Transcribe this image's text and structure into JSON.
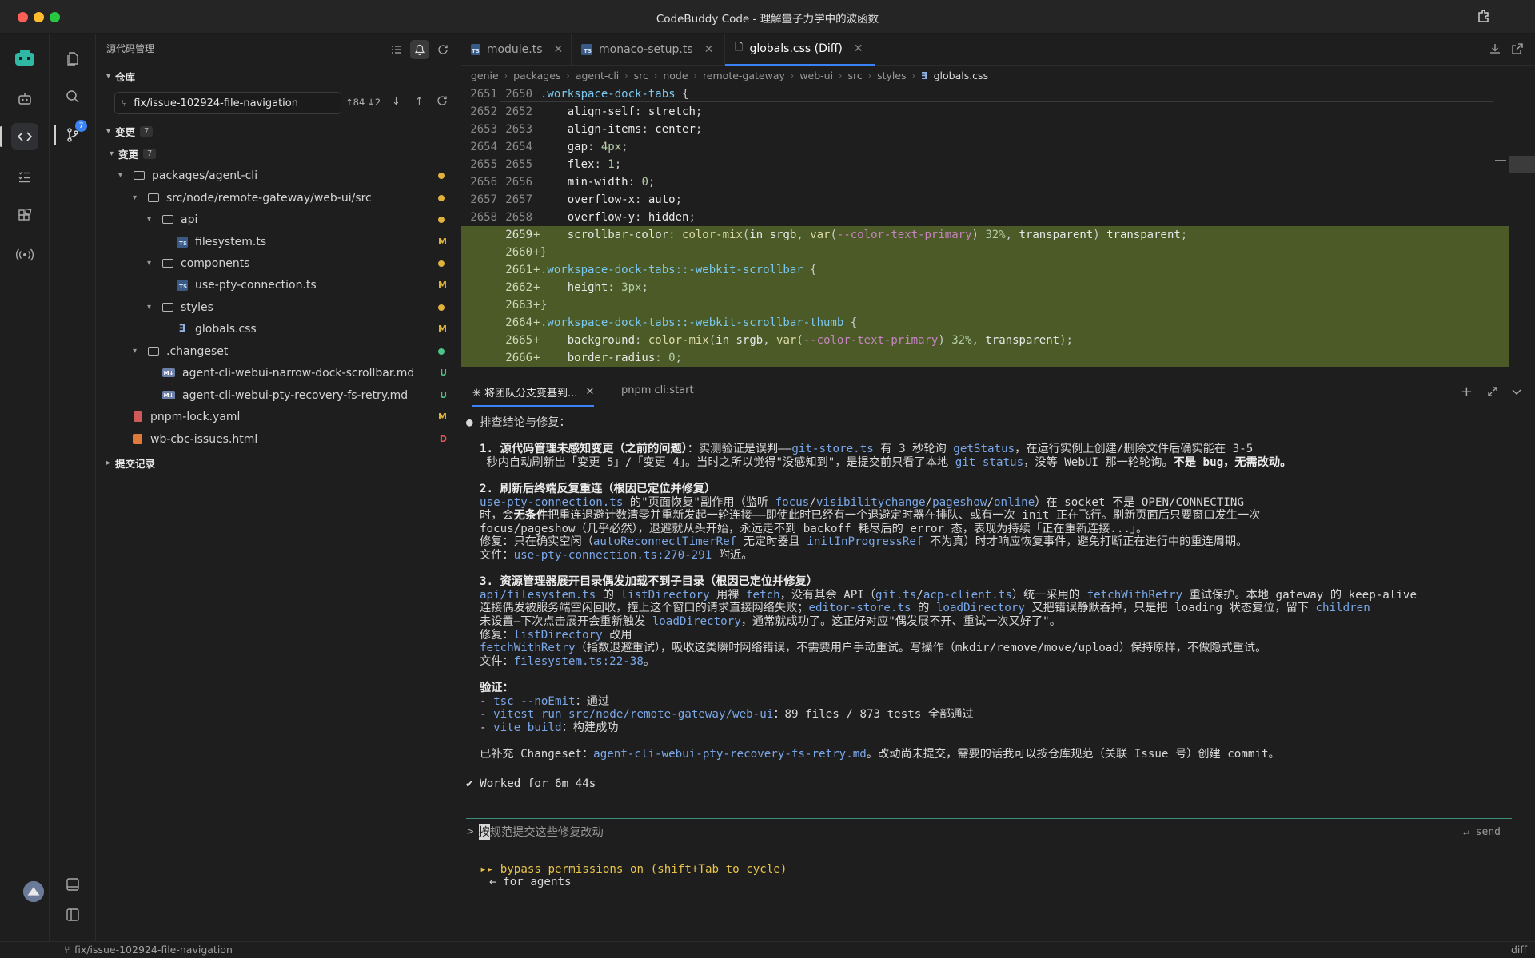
{
  "window": {
    "title": "CodeBuddy Code - 理解量子力学中的波函数"
  },
  "activity_bar": {
    "source_control_badge": "7"
  },
  "sidebar": {
    "title": "源代码管理",
    "repo_section": "仓库",
    "branch": "fix/issue-102924-file-navigation",
    "sync_ahead": "↑84",
    "sync_behind": "↓2",
    "changes_section": "变更",
    "changes_count": "7",
    "changes_group": "变更",
    "changes_group_count": "7",
    "commits_section": "提交记录",
    "tree": [
      {
        "label": "packages/agent-cli",
        "status": ""
      },
      {
        "label": "src/node/remote-gateway/web-ui/src",
        "status": ""
      },
      {
        "label": "api",
        "status": ""
      },
      {
        "label": "filesystem.ts",
        "status": "M"
      },
      {
        "label": "components",
        "status": ""
      },
      {
        "label": "use-pty-connection.ts",
        "status": "M"
      },
      {
        "label": "styles",
        "status": ""
      },
      {
        "label": "globals.css",
        "status": "M"
      },
      {
        "label": ".changeset",
        "status": ""
      },
      {
        "label": "agent-cli-webui-narrow-dock-scrollbar.md",
        "status": "U"
      },
      {
        "label": "agent-cli-webui-pty-recovery-fs-retry.md",
        "status": "U"
      },
      {
        "label": "pnpm-lock.yaml",
        "status": "M"
      },
      {
        "label": "wb-cbc-issues.html",
        "status": "D"
      }
    ]
  },
  "editor": {
    "tabs": [
      {
        "label": "module.ts"
      },
      {
        "label": "monaco-setup.ts"
      },
      {
        "label": "globals.css (Diff)"
      }
    ],
    "breadcrumb": [
      "genie",
      "packages",
      "agent-cli",
      "src",
      "node",
      "remote-gateway",
      "web-ui",
      "src",
      "styles",
      "globals.css"
    ],
    "code_lines": [
      {
        "old": "2651",
        "new": "2650",
        "text": ".workspace-dock-tabs {"
      },
      {
        "old": "2652",
        "new": "2652",
        "text": "    align-self: stretch;"
      },
      {
        "old": "2653",
        "new": "2653",
        "text": "    align-items: center;"
      },
      {
        "old": "2654",
        "new": "2654",
        "text": "    gap: 4px;"
      },
      {
        "old": "2655",
        "new": "2655",
        "text": "    flex: 1;"
      },
      {
        "old": "2656",
        "new": "2656",
        "text": "    min-width: 0;"
      },
      {
        "old": "2657",
        "new": "2657",
        "text": "    overflow-x: auto;"
      },
      {
        "old": "2658",
        "new": "2658",
        "text": "    overflow-y: hidden;"
      },
      {
        "old": "",
        "new": "2659",
        "text": "    scrollbar-color: color-mix(in srgb, var(--color-text-primary) 32%, transparent) transparent;"
      },
      {
        "old": "",
        "new": "2660",
        "text": "}"
      },
      {
        "old": "",
        "new": "2661",
        "text": ".workspace-dock-tabs::-webkit-scrollbar {"
      },
      {
        "old": "",
        "new": "2662",
        "text": "    height: 3px;"
      },
      {
        "old": "",
        "new": "2663",
        "text": "}"
      },
      {
        "old": "",
        "new": "2664",
        "text": ".workspace-dock-tabs::-webkit-scrollbar-thumb {"
      },
      {
        "old": "",
        "new": "2665",
        "text": "    background: color-mix(in srgb, var(--color-text-primary) 32%, transparent);"
      },
      {
        "old": "",
        "new": "2666",
        "text": "    border-radius: 0;"
      }
    ]
  },
  "terminal": {
    "tabs": [
      {
        "label": "✳ 将团队分支变基到..."
      },
      {
        "label": "pnpm cli:start"
      }
    ],
    "lines": [
      {
        "row": 0,
        "spans": [
          {
            "t": "● 排查结论与修复：",
            "c": ""
          }
        ]
      },
      {
        "row": 2,
        "spans": [
          {
            "t": "1. 源代码管理未感知变更（之前的问题）",
            "c": "tb"
          },
          {
            "t": "：实测验证是误判——",
            "c": ""
          },
          {
            "t": "git-store.ts",
            "c": "tlink"
          },
          {
            "t": " 有 3 秒轮询 ",
            "c": ""
          },
          {
            "t": "getStatus",
            "c": "tlink"
          },
          {
            "t": "，在运行实例上创建/删除文件后确实能在 3-5",
            "c": ""
          }
        ]
      },
      {
        "row": 3,
        "spans": [
          {
            "t": " 秒内自动刷新出「变更 5」/「变更 4」。当时之所以觉得\"没感知到\"，是提交前只看了本地 ",
            "c": ""
          },
          {
            "t": "git status",
            "c": "tlink"
          },
          {
            "t": "，没等 WebUI 那一轮轮询。",
            "c": ""
          },
          {
            "t": "不是 bug，无需改动。",
            "c": "tb"
          }
        ]
      },
      {
        "row": 5,
        "spans": [
          {
            "t": "2. 刷新后终端反复重连（根因已定位并修复）",
            "c": "tb"
          }
        ]
      },
      {
        "row": 6,
        "spans": [
          {
            "t": "use-pty-connection.ts",
            "c": "tlink"
          },
          {
            "t": " 的\"页面恢复\"副作用（监听 ",
            "c": ""
          },
          {
            "t": "focus",
            "c": "tlink"
          },
          {
            "t": "/",
            "c": ""
          },
          {
            "t": "visibilitychange",
            "c": "tlink"
          },
          {
            "t": "/",
            "c": ""
          },
          {
            "t": "pageshow",
            "c": "tlink"
          },
          {
            "t": "/",
            "c": ""
          },
          {
            "t": "online",
            "c": "tlink"
          },
          {
            "t": "）在 socket 不是 OPEN/CONNECTING",
            "c": ""
          }
        ]
      },
      {
        "row": 7,
        "spans": [
          {
            "t": "时，会",
            "c": ""
          },
          {
            "t": "无条件",
            "c": "tb"
          },
          {
            "t": "把重连退避计数清零并重新发起一轮连接——即使此时已经有一个退避定时器在排队、或有一次 init 正在飞行。刷新页面后只要窗口发生一次",
            "c": ""
          }
        ]
      },
      {
        "row": 8,
        "spans": [
          {
            "t": "focus/pageshow（几乎必然），退避就从头开始，永远走不到 backoff 耗尽后的 error 态，表现为持续「正在重新连接...」。",
            "c": ""
          }
        ]
      },
      {
        "row": 9,
        "spans": [
          {
            "t": "修复：只在确实空闲（",
            "c": ""
          },
          {
            "t": "autoReconnectTimerRef",
            "c": "tlink"
          },
          {
            "t": " 无定时器且 ",
            "c": ""
          },
          {
            "t": "initInProgressRef",
            "c": "tlink"
          },
          {
            "t": " 不为真）时才响应恢复事件，避免打断正在进行中的重连周期。",
            "c": ""
          }
        ]
      },
      {
        "row": 10,
        "spans": [
          {
            "t": "文件：",
            "c": ""
          },
          {
            "t": "use-pty-connection.ts:270-291",
            "c": "tlink"
          },
          {
            "t": " 附近。",
            "c": ""
          }
        ]
      },
      {
        "row": 12,
        "spans": [
          {
            "t": "3. 资源管理器展开目录偶发加载不到子目录（根因已定位并修复）",
            "c": "tb"
          }
        ]
      },
      {
        "row": 13,
        "spans": [
          {
            "t": "api/filesystem.ts",
            "c": "tlink"
          },
          {
            "t": " 的 ",
            "c": ""
          },
          {
            "t": "listDirectory",
            "c": "tlink"
          },
          {
            "t": " 用裸 ",
            "c": ""
          },
          {
            "t": "fetch",
            "c": "tlink"
          },
          {
            "t": "，没有其余 API（",
            "c": ""
          },
          {
            "t": "git.ts",
            "c": "tlink"
          },
          {
            "t": "/",
            "c": ""
          },
          {
            "t": "acp-client.ts",
            "c": "tlink"
          },
          {
            "t": "）统一采用的 ",
            "c": ""
          },
          {
            "t": "fetchWithRetry",
            "c": "tlink"
          },
          {
            "t": " 重试保护。本地 gateway 的 keep-alive",
            "c": ""
          }
        ]
      },
      {
        "row": 14,
        "spans": [
          {
            "t": "连接偶发被服务端空闲回收，撞上这个窗口的请求直接网络失败；",
            "c": ""
          },
          {
            "t": "editor-store.ts",
            "c": "tlink"
          },
          {
            "t": " 的 ",
            "c": ""
          },
          {
            "t": "loadDirectory",
            "c": "tlink"
          },
          {
            "t": " 又把错误静默吞掉，只是把 loading 状态复位，留下 ",
            "c": ""
          },
          {
            "t": "children",
            "c": "tlink"
          }
        ]
      },
      {
        "row": 15,
        "spans": [
          {
            "t": "未设置—下次点击展开会重新触发 ",
            "c": ""
          },
          {
            "t": "loadDirectory",
            "c": "tlink"
          },
          {
            "t": "，通常就成功了。这正好对应\"偶发展不开、重试一次又好了\"。",
            "c": ""
          }
        ]
      },
      {
        "row": 16,
        "spans": [
          {
            "t": "修复：",
            "c": ""
          },
          {
            "t": "listDirectory",
            "c": "tlink"
          },
          {
            "t": " 改用",
            "c": ""
          }
        ]
      },
      {
        "row": 17,
        "spans": [
          {
            "t": "fetchWithRetry",
            "c": "tlink"
          },
          {
            "t": "（指数退避重试），吸收这类瞬时网络错误，不需要用户手动重试。写操作（mkdir/remove/move/upload）保持原样，不做隐式重试。",
            "c": ""
          }
        ]
      },
      {
        "row": 18,
        "spans": [
          {
            "t": "文件：",
            "c": ""
          },
          {
            "t": "filesystem.ts:22-38",
            "c": "tlink"
          },
          {
            "t": "。",
            "c": ""
          }
        ]
      },
      {
        "row": 20,
        "spans": [
          {
            "t": "验证：",
            "c": "tb"
          }
        ]
      },
      {
        "row": 21,
        "spans": [
          {
            "t": "- ",
            "c": ""
          },
          {
            "t": "tsc --noEmit",
            "c": "tlink"
          },
          {
            "t": "：通过",
            "c": ""
          }
        ]
      },
      {
        "row": 22,
        "spans": [
          {
            "t": "- ",
            "c": ""
          },
          {
            "t": "vitest run src/node/remote-gateway/web-ui",
            "c": "tlink"
          },
          {
            "t": "：89 files / 873 tests 全部通过",
            "c": ""
          }
        ]
      },
      {
        "row": 23,
        "spans": [
          {
            "t": "- ",
            "c": ""
          },
          {
            "t": "vite build",
            "c": "tlink"
          },
          {
            "t": "：构建成功",
            "c": ""
          }
        ]
      },
      {
        "row": 25,
        "spans": [
          {
            "t": "已补充 Changeset：",
            "c": ""
          },
          {
            "t": "agent-cli-webui-pty-recovery-fs-retry.md",
            "c": "tlink"
          },
          {
            "t": "。改动尚未提交，需要的话我可以按仓库规范（关联 Issue 号）创建 commit。",
            "c": ""
          }
        ]
      },
      {
        "row": 27,
        "spans": [
          {
            "t": "✔ Worked for 6m 44s",
            "c": "tgreen"
          }
        ]
      }
    ],
    "prompt_symbol": ">",
    "prompt_cursor_char": "按",
    "prompt_text": "规范提交这些修复改动",
    "send_label": "↵ send",
    "bypass_text": "▸▸ bypass permissions on (shift+Tab to cycle)",
    "agents_hint": "← for agents"
  },
  "statusbar": {
    "branch": "fix/issue-102924-file-navigation",
    "right_label": "diff"
  }
}
